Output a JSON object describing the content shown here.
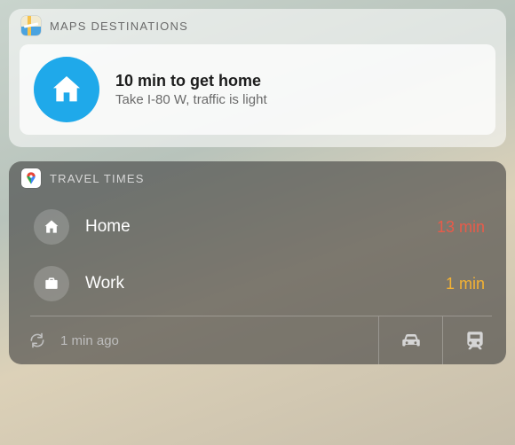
{
  "maps_widget": {
    "header_title": "MAPS DESTINATIONS",
    "icon_name": "apple-maps-icon",
    "destination": {
      "icon_name": "home-icon",
      "title": "10 min to get home",
      "subtitle": "Take I-80 W, traffic is light"
    }
  },
  "travel_widget": {
    "header_title": "TRAVEL TIMES",
    "icon_name": "google-maps-icon",
    "rows": [
      {
        "icon_name": "home-icon",
        "label": "Home",
        "time": "13 min",
        "severity": "red"
      },
      {
        "icon_name": "briefcase-icon",
        "label": "Work",
        "time": "1 min",
        "severity": "amber"
      }
    ],
    "footer": {
      "refresh_icon": "refresh-icon",
      "last_updated": "1 min ago",
      "modes": [
        {
          "icon_name": "car-icon",
          "selected": true
        },
        {
          "icon_name": "train-icon",
          "selected": false
        }
      ]
    }
  }
}
